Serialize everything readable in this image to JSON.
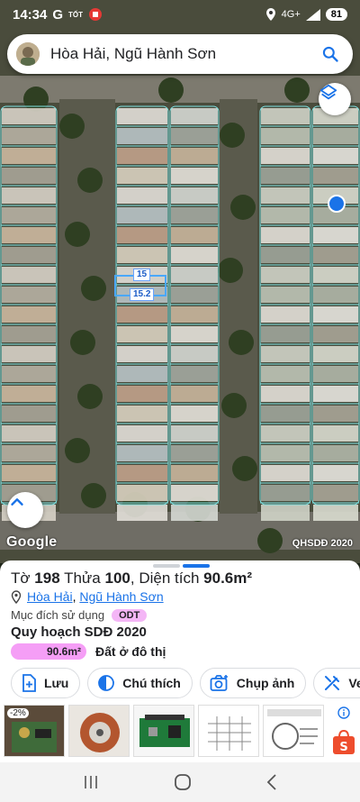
{
  "status_bar": {
    "time": "14:34",
    "indicators": [
      "google-icon",
      "tot-icon",
      "notification-icon"
    ],
    "tot_label": "TỐT",
    "network": "4G+",
    "battery": "81"
  },
  "search": {
    "query": "Hòa Hải, Ngũ Hành Sơn"
  },
  "map": {
    "dimension_labels": [
      "15",
      "15.2"
    ],
    "attribution": "Google",
    "overlay_name": "QHSDĐ 2020"
  },
  "parcel": {
    "sheet_label": "Tờ",
    "sheet_number": "198",
    "plot_label": "Thửa",
    "plot_number": "100",
    "area_label": "Diện tích",
    "area": "90.6m²",
    "ward": "Hòa Hải",
    "district": "Ngũ Hành Sơn",
    "separator": ",",
    "purpose_label": "Mục đích sử dụng",
    "purpose_code": "ODT",
    "plan_title": "Quy hoạch SDĐ 2020",
    "plan_area": "90.6m²",
    "plan_area_fraction": 1.0,
    "plan_area_color": "#f59ef6",
    "plan_use": "Đất ở đô thị"
  },
  "actions": [
    {
      "label": "Lưu",
      "icon": "save-icon"
    },
    {
      "label": "Chú thích",
      "icon": "legend-icon"
    },
    {
      "label": "Chụp ảnh",
      "icon": "camera-icon"
    },
    {
      "label": "Ve",
      "icon": "draw-icon"
    }
  ],
  "ads": {
    "badge": "-2%",
    "info_icon": "info-icon",
    "store_icon": "shopee-icon"
  },
  "colors": {
    "accent": "#1a73e8",
    "parcel_line": "#7fe3e3",
    "selection": "#4aa8ff",
    "purpose_badge": "#f4b6f6"
  },
  "nav": [
    "recents-icon",
    "home-icon",
    "back-icon"
  ]
}
